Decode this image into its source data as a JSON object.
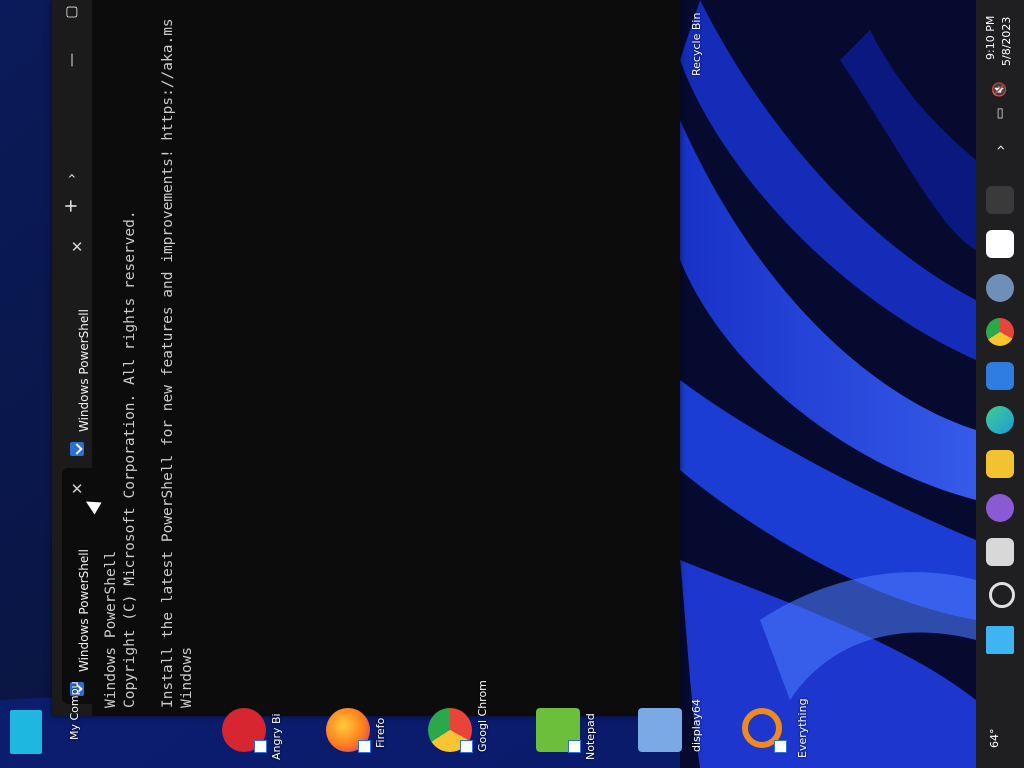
{
  "terminal": {
    "tabs": [
      {
        "title": "Windows PowerShell",
        "icon": "powershell-icon"
      },
      {
        "title": "Windows PowerShell",
        "icon": "powershell-icon"
      }
    ],
    "buttons": {
      "close_tab": "✕",
      "new_tab": "+",
      "dropdown": "›",
      "minimize": "—",
      "maximize": "▢"
    },
    "lines": [
      "Windows PowerShell",
      "Copyright (C) Microsoft Corporation. All rights reserved.",
      "Install the latest PowerShell for new features and improvements! https://aka.ms",
      "Windows"
    ]
  },
  "desktop": {
    "recycle_bin": "Recycle Bin",
    "icons": [
      {
        "label": "My Compu",
        "icon": "my-computer-icon",
        "color": "#1fb6e0"
      },
      {
        "label": "Angry Bi",
        "icon": "angry-birds-icon",
        "color": "#d7262f"
      },
      {
        "label": "Firefo",
        "icon": "firefox-icon",
        "color": "#ff7b1c"
      },
      {
        "label": "Googl Chrom",
        "icon": "chrome-icon",
        "color": "#e9443a"
      },
      {
        "label": "Notepad",
        "icon": "notepad-icon",
        "color": "#6cbf3a"
      },
      {
        "label": "display64",
        "icon": "display-icon",
        "color": "#7aa9e6"
      },
      {
        "label": "Everything",
        "icon": "everything-search-icon",
        "color": "#f08a1c"
      }
    ]
  },
  "taskbar": {
    "time": "9:10 PM",
    "date": "5/8/2023",
    "weather": "64°",
    "apps": [
      {
        "name": "terminal-app",
        "color": "#3a3a3a"
      },
      {
        "name": "7zip-app",
        "color": "#ffffff"
      },
      {
        "name": "settings-app",
        "color": "#6e8fb8"
      },
      {
        "name": "chrome-app",
        "color": "#e9443a"
      },
      {
        "name": "store-app",
        "color": "#2f7de1"
      },
      {
        "name": "edge-app",
        "color": "#1f9bd8"
      },
      {
        "name": "file-explorer-app",
        "color": "#f2c230"
      },
      {
        "name": "purple-app",
        "color": "#8a5ad6"
      },
      {
        "name": "copy-app",
        "color": "#d8d8d8"
      },
      {
        "name": "search-app",
        "color": "#e0e0e0"
      },
      {
        "name": "start-app",
        "color": "#3fb4f2"
      }
    ]
  }
}
